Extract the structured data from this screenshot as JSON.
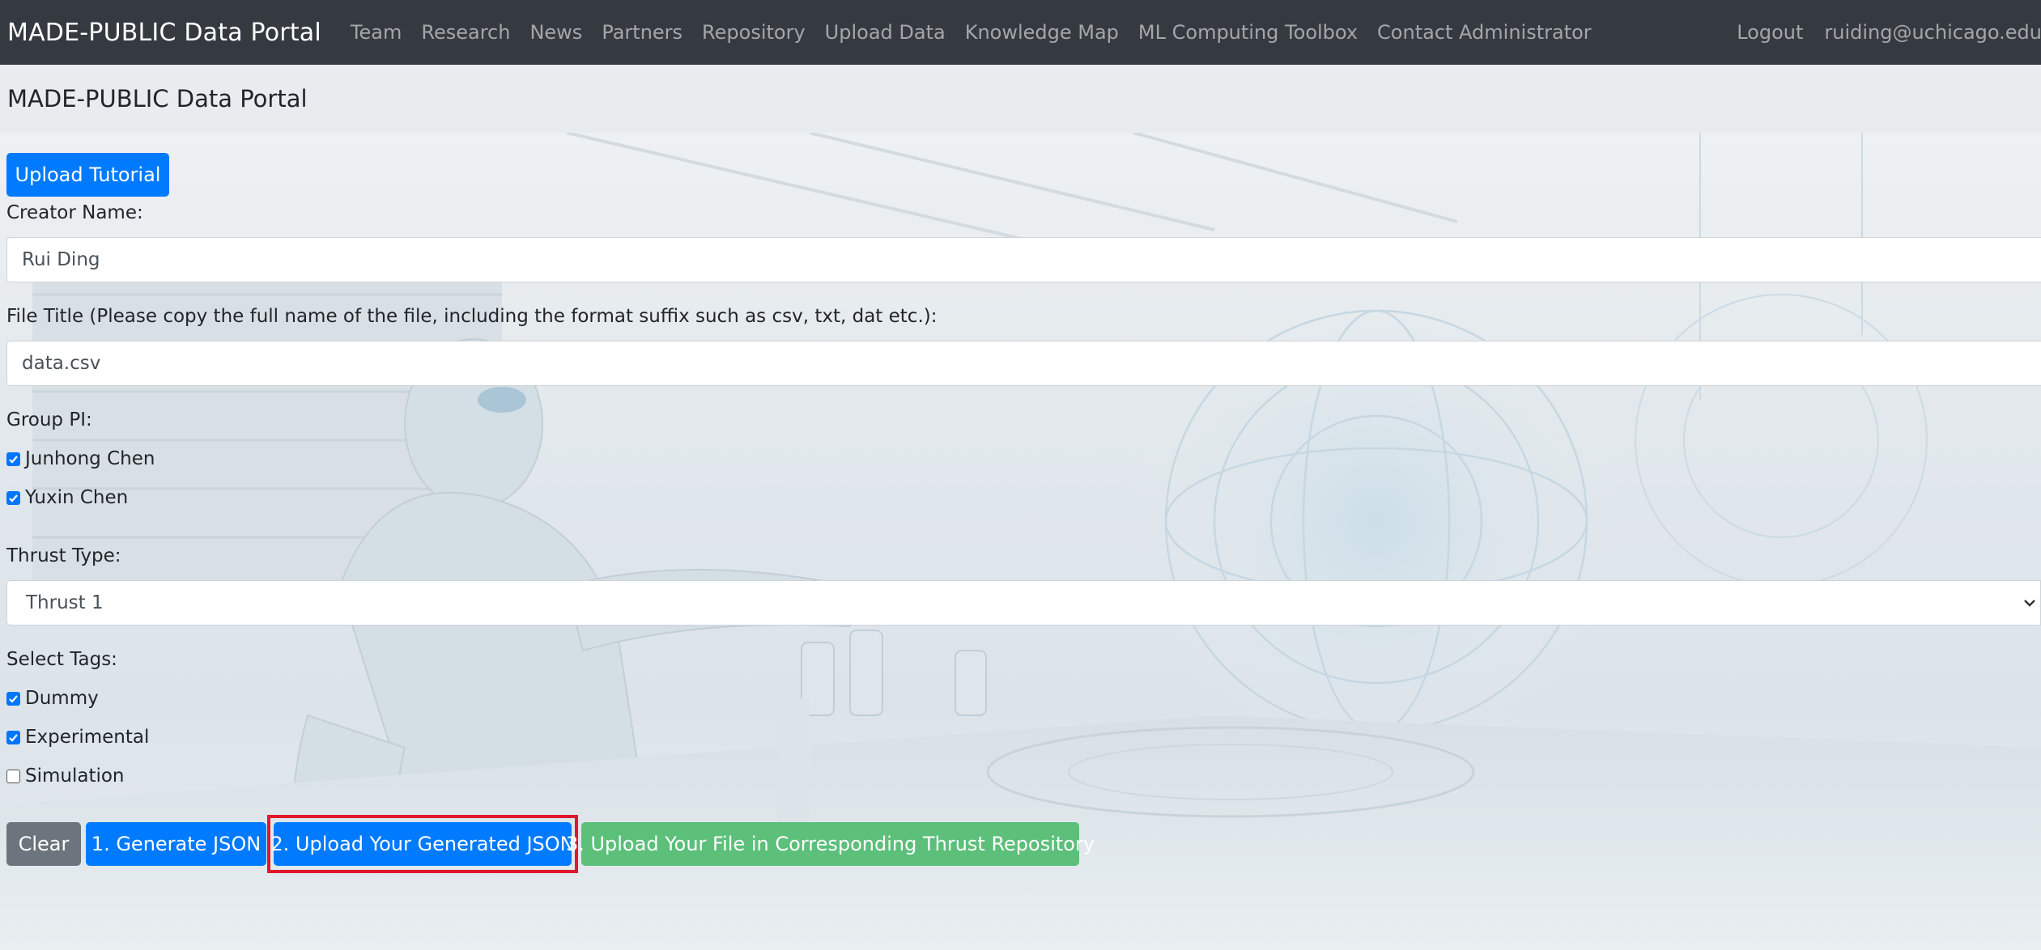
{
  "navbar": {
    "brand": "MADE-PUBLIC Data Portal",
    "links": [
      "Team",
      "Research",
      "News",
      "Partners",
      "Repository",
      "Upload Data",
      "Knowledge Map",
      "ML Computing Toolbox",
      "Contact Administrator"
    ],
    "logout": "Logout",
    "user_email": "ruiding@uchicago.edu"
  },
  "page_header": {
    "title": "MADE-PUBLIC Data Portal"
  },
  "form": {
    "tutorial_button": "Upload Tutorial",
    "creator_label": "Creator Name:",
    "creator_value": "Rui Ding",
    "file_title_label": "File Title (Please copy the full name of the file, including the format suffix such as csv, txt, dat etc.):",
    "file_title_value": "data.csv",
    "group_pi_label": "Group PI:",
    "group_pi_options": [
      {
        "label": "Junhong Chen",
        "checked": true
      },
      {
        "label": "Yuxin Chen",
        "checked": true
      }
    ],
    "thrust_label": "Thrust Type:",
    "thrust_selected": "Thrust 1",
    "tags_label": "Select Tags:",
    "tags": [
      {
        "label": "Dummy",
        "checked": true
      },
      {
        "label": "Experimental",
        "checked": true
      },
      {
        "label": "Simulation",
        "checked": false
      }
    ],
    "buttons": {
      "clear": "Clear",
      "generate_json": "1. Generate JSON",
      "upload_json": "2. Upload Your Generated JSON",
      "upload_file": "3. Upload Your File in Corresponding Thrust Repository"
    }
  },
  "colors": {
    "navbar_bg": "#343a40",
    "primary": "#007bff",
    "secondary": "#6c757d",
    "success": "#5cbf7a",
    "highlight": "#e0182a"
  },
  "icons": {
    "select_chevron": "chevron-down-icon",
    "checkbox_mark": "check-icon"
  }
}
